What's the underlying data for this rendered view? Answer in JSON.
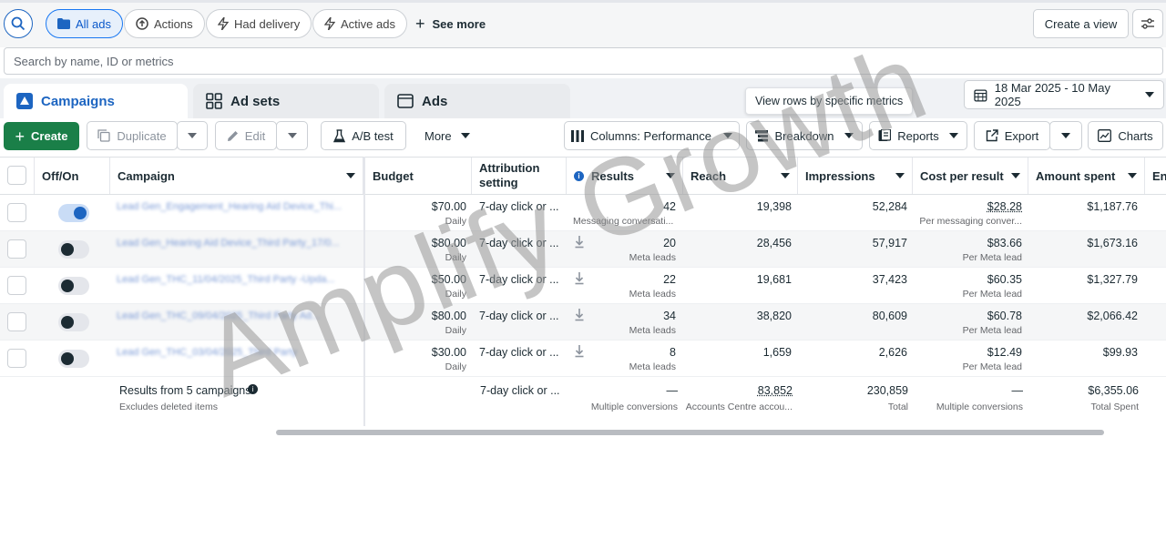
{
  "filters": {
    "all_ads": "All ads",
    "actions": "Actions",
    "had_delivery": "Had delivery",
    "active_ads": "Active ads",
    "see_more": "See more",
    "create_view": "Create a view"
  },
  "search": {
    "placeholder": "Search by name, ID or metrics"
  },
  "tabs": [
    {
      "label": "Campaigns",
      "icon": "campaign-icon"
    },
    {
      "label": "Ad sets",
      "icon": "grid-icon"
    },
    {
      "label": "Ads",
      "icon": "ad-frame-icon"
    }
  ],
  "tooltip": "View rows by specific metrics",
  "date_range": "18 Mar 2025 - 10 May 2025",
  "toolbar": {
    "create": "Create",
    "duplicate": "Duplicate",
    "edit": "Edit",
    "ab_test": "A/B test",
    "more": "More",
    "columns": "Columns: Performance",
    "breakdown": "Breakdown",
    "reports": "Reports",
    "export": "Export",
    "charts": "Charts"
  },
  "columns": {
    "offon": "Off/On",
    "campaign": "Campaign",
    "budget": "Budget",
    "attribution": "Attribution setting",
    "results": "Results",
    "reach": "Reach",
    "impressions": "Impressions",
    "cost_per_result": "Cost per result",
    "amount_spent": "Amount spent",
    "ends": "En"
  },
  "rows": [
    {
      "campaign": "Lead Gen_Engagement_Hearing Aid Device_Thi...",
      "on": true,
      "budget": "$70.00",
      "budget_sub": "Daily",
      "attribution": "7-day click or ...",
      "results": "42",
      "results_sub": "Messaging conversati...",
      "reach": "19,398",
      "impressions": "52,284",
      "cpr": "$28.28",
      "cpr_sub": "Per messaging conver...",
      "spent": "$1,187.76"
    },
    {
      "campaign": "Lead Gen_Hearing Aid Device_Third Party_17/0...",
      "on": false,
      "budget": "$80.00",
      "budget_sub": "Daily",
      "attribution": "7-day click or ...",
      "results": "20",
      "results_sub": "Meta leads",
      "reach": "28,456",
      "impressions": "57,917",
      "cpr": "$83.66",
      "cpr_sub": "Per Meta lead",
      "spent": "$1,673.16"
    },
    {
      "campaign": "Lead Gen_THC_11/04/2025_Third Party -Upda...",
      "on": false,
      "budget": "$50.00",
      "budget_sub": "Daily",
      "attribution": "7-day click or ...",
      "results": "22",
      "results_sub": "Meta leads",
      "reach": "19,681",
      "impressions": "37,423",
      "cpr": "$60.35",
      "cpr_sub": "Per Meta lead",
      "spent": "$1,327.79"
    },
    {
      "campaign": "Lead Gen_THC_09/04/2025_Third Party Ad...",
      "on": false,
      "budget": "$80.00",
      "budget_sub": "Daily",
      "attribution": "7-day click or ...",
      "results": "34",
      "results_sub": "Meta leads",
      "reach": "38,820",
      "impressions": "80,609",
      "cpr": "$60.78",
      "cpr_sub": "Per Meta lead",
      "spent": "$2,066.42"
    },
    {
      "campaign": "Lead Gen_THC_03/04/2025_Third Party",
      "on": false,
      "budget": "$30.00",
      "budget_sub": "Daily",
      "attribution": "7-day click or ...",
      "results": "8",
      "results_sub": "Meta leads",
      "reach": "1,659",
      "impressions": "2,626",
      "cpr": "$12.49",
      "cpr_sub": "Per Meta lead",
      "spent": "$99.93"
    }
  ],
  "totals": {
    "label": "Results from 5 campaigns",
    "label_sub": "Excludes deleted items",
    "attribution": "7-day click or ...",
    "results": "—",
    "results_sub": "Multiple conversions",
    "reach": "83,852",
    "reach_sub": "Accounts Centre accou...",
    "impressions": "230,859",
    "impressions_sub": "Total",
    "cpr": "—",
    "cpr_sub": "Multiple conversions",
    "spent": "$6,355.06",
    "spent_sub": "Total Spent"
  },
  "watermark": "Amplify Growth",
  "colors": {
    "primary": "#1d65c1",
    "create_green": "#1a7f48",
    "watermark": "#969696"
  }
}
